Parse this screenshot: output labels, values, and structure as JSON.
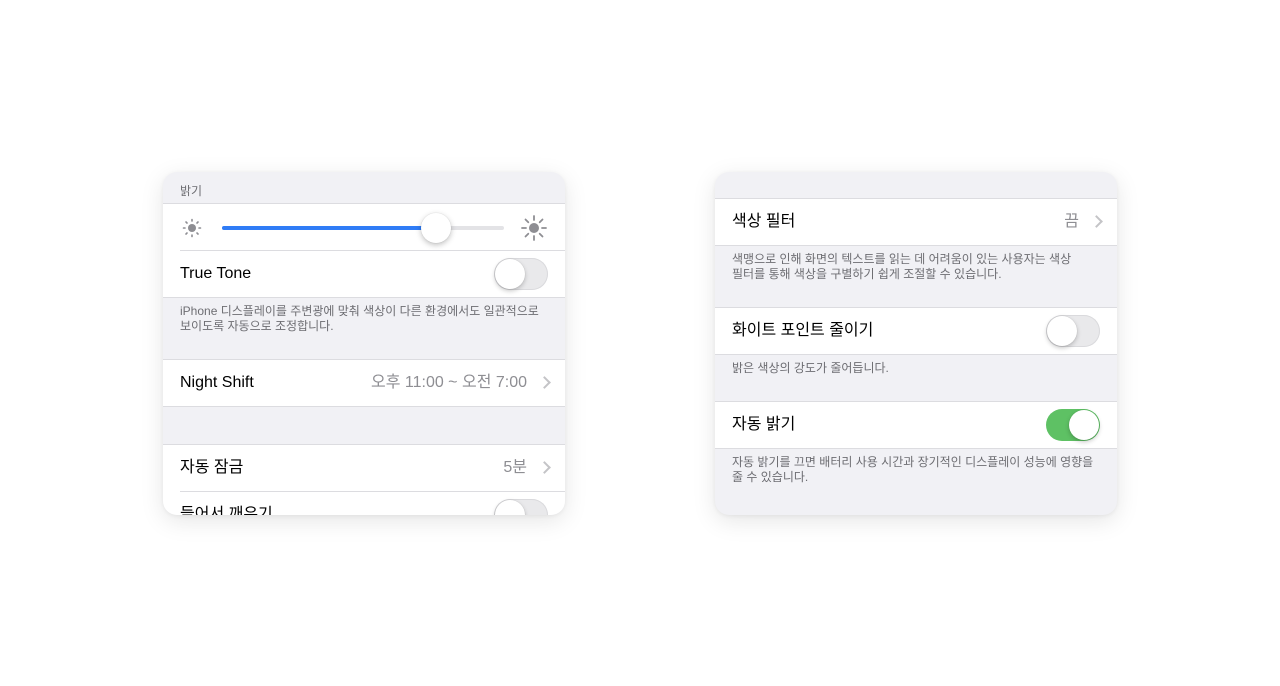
{
  "colors": {
    "accent_blue": "#2f7cf6",
    "switch_on_green": "#5ec164",
    "grouped_background": "#f1f1f5",
    "secondary_text": "#6d6d72"
  },
  "left_panel": {
    "brightness_header": "밝기",
    "brightness_slider": {
      "value": 0.76,
      "min_icon": "sun-small-icon",
      "max_icon": "sun-large-icon"
    },
    "true_tone": {
      "label": "True Tone",
      "enabled": false
    },
    "true_tone_footer_line1": "iPhone 디스플레이를 주변광에 맞춰 색상이 다른 환경에서도 일관적으로",
    "true_tone_footer_line2": "보이도록 자동으로 조정합니다.",
    "night_shift": {
      "label": "Night Shift",
      "value": "오후 11:00 ~ 오전 7:00"
    },
    "auto_lock": {
      "label": "자동 잠금",
      "value": "5분"
    },
    "raise_to_wake": {
      "label": "들어서 깨우기",
      "enabled": false
    }
  },
  "right_panel": {
    "color_filters": {
      "label": "색상 필터",
      "value": "끔"
    },
    "color_filters_footer_line1": "색맹으로 인해 화면의 텍스트를 읽는 데 어려움이 있는 사용자는 색상",
    "color_filters_footer_line2": "필터를 통해 색상을 구별하기 쉽게 조절할 수 있습니다.",
    "reduce_white_point": {
      "label": "화이트 포인트 줄이기",
      "enabled": false
    },
    "reduce_white_point_footer": "밝은 색상의 강도가 줄어듭니다.",
    "auto_brightness": {
      "label": "자동 밝기",
      "enabled": true
    },
    "auto_brightness_footer_line1": "자동 밝기를 끄면 배터리 사용 시간과 장기적인 디스플레이 성능에 영향을",
    "auto_brightness_footer_line2": "줄 수 있습니다."
  }
}
